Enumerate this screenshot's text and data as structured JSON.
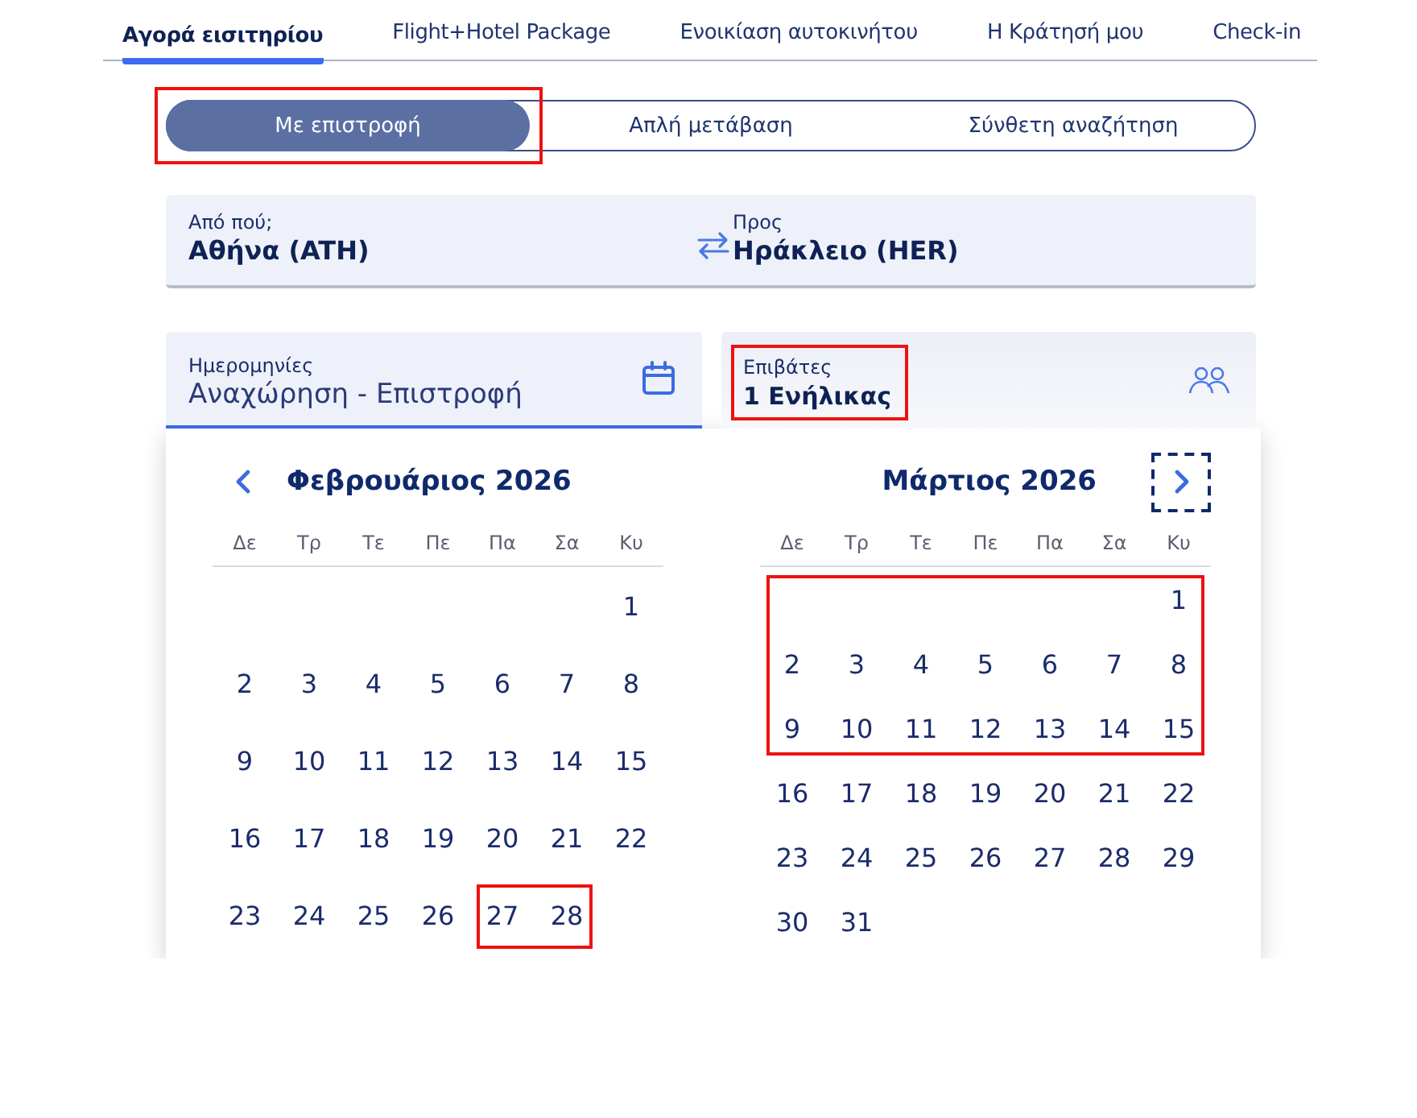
{
  "tabs": [
    {
      "label": "Αγορά εισιτηρίου",
      "selected": true
    },
    {
      "label": "Flight+Hotel Package",
      "selected": false
    },
    {
      "label": "Ενοικίαση αυτοκινήτου",
      "selected": false
    },
    {
      "label": "Η Κράτησή μου",
      "selected": false
    },
    {
      "label": "Check-in",
      "selected": false
    }
  ],
  "trip_types": [
    {
      "label": "Με επιστροφή",
      "selected": true,
      "highlighted": true
    },
    {
      "label": "Απλή μετάβαση",
      "selected": false,
      "highlighted": false
    },
    {
      "label": "Σύνθετη αναζήτηση",
      "selected": false,
      "highlighted": false
    }
  ],
  "route": {
    "from": {
      "label": "Από πού;",
      "value": "Αθήνα (ATH)"
    },
    "to": {
      "label": "Προς",
      "value": "Ηράκλειο (HER)"
    }
  },
  "dates": {
    "label": "Ημερομηνίες",
    "value": "Αναχώρηση - Επιστροφή",
    "selected": true
  },
  "passengers": {
    "label": "Επιβάτες",
    "value": "1 Ενήλικας",
    "selected": false,
    "highlighted": true
  },
  "calendar": {
    "next_focused": true,
    "months": [
      {
        "title": "Φεβρουάριος 2026",
        "weekdays": [
          "Δε",
          "Τρ",
          "Τε",
          "Πε",
          "Πα",
          "Σα",
          "Κυ"
        ],
        "day_groups": [
          {
            "highlighted": false,
            "days": [
              {
                "kind": "blank"
              },
              {
                "kind": "blank"
              },
              {
                "kind": "blank"
              },
              {
                "kind": "blank"
              },
              {
                "kind": "blank"
              },
              {
                "kind": "blank"
              },
              {
                "kind": "day",
                "label": "1"
              },
              {
                "kind": "day",
                "label": "2"
              },
              {
                "kind": "day",
                "label": "3"
              },
              {
                "kind": "day",
                "label": "4"
              },
              {
                "kind": "day",
                "label": "5"
              },
              {
                "kind": "day",
                "label": "6"
              },
              {
                "kind": "day",
                "label": "7"
              },
              {
                "kind": "day",
                "label": "8"
              },
              {
                "kind": "day",
                "label": "9"
              },
              {
                "kind": "day",
                "label": "10"
              },
              {
                "kind": "day",
                "label": "11"
              },
              {
                "kind": "day",
                "label": "12"
              },
              {
                "kind": "day",
                "label": "13"
              },
              {
                "kind": "day",
                "label": "14"
              },
              {
                "kind": "day",
                "label": "15"
              },
              {
                "kind": "day",
                "label": "16"
              },
              {
                "kind": "day",
                "label": "17"
              },
              {
                "kind": "day",
                "label": "18"
              },
              {
                "kind": "day",
                "label": "19"
              },
              {
                "kind": "day",
                "label": "20"
              },
              {
                "kind": "day",
                "label": "21"
              },
              {
                "kind": "day",
                "label": "22"
              },
              {
                "kind": "day",
                "label": "23"
              },
              {
                "kind": "day",
                "label": "24"
              },
              {
                "kind": "day",
                "label": "25"
              },
              {
                "kind": "day",
                "label": "26"
              }
            ]
          },
          {
            "highlighted": true,
            "days": [
              {
                "kind": "day",
                "label": "27"
              },
              {
                "kind": "day",
                "label": "28"
              }
            ]
          }
        ]
      },
      {
        "title": "Μάρτιος 2026",
        "weekdays": [
          "Δε",
          "Τρ",
          "Τε",
          "Πε",
          "Πα",
          "Σα",
          "Κυ"
        ],
        "day_groups": [
          {
            "highlighted": true,
            "days": [
              {
                "kind": "blank"
              },
              {
                "kind": "blank"
              },
              {
                "kind": "blank"
              },
              {
                "kind": "blank"
              },
              {
                "kind": "blank"
              },
              {
                "kind": "blank"
              },
              {
                "kind": "day",
                "label": "1"
              },
              {
                "kind": "day",
                "label": "2"
              },
              {
                "kind": "day",
                "label": "3"
              },
              {
                "kind": "day",
                "label": "4"
              },
              {
                "kind": "day",
                "label": "5"
              },
              {
                "kind": "day",
                "label": "6"
              },
              {
                "kind": "day",
                "label": "7"
              },
              {
                "kind": "day",
                "label": "8"
              },
              {
                "kind": "day",
                "label": "9"
              },
              {
                "kind": "day",
                "label": "10"
              },
              {
                "kind": "day",
                "label": "11"
              },
              {
                "kind": "day",
                "label": "12"
              },
              {
                "kind": "day",
                "label": "13"
              },
              {
                "kind": "day",
                "label": "14"
              },
              {
                "kind": "day",
                "label": "15"
              }
            ]
          },
          {
            "highlighted": false,
            "days": [
              {
                "kind": "day",
                "label": "16"
              },
              {
                "kind": "day",
                "label": "17"
              },
              {
                "kind": "day",
                "label": "18"
              },
              {
                "kind": "day",
                "label": "19"
              },
              {
                "kind": "day",
                "label": "20"
              },
              {
                "kind": "day",
                "label": "21"
              },
              {
                "kind": "day",
                "label": "22"
              },
              {
                "kind": "day",
                "label": "23"
              },
              {
                "kind": "day",
                "label": "24"
              },
              {
                "kind": "day",
                "label": "25"
              },
              {
                "kind": "day",
                "label": "26"
              },
              {
                "kind": "day",
                "label": "27"
              },
              {
                "kind": "day",
                "label": "28"
              },
              {
                "kind": "day",
                "label": "29"
              },
              {
                "kind": "day",
                "label": "30"
              },
              {
                "kind": "day",
                "label": "31"
              }
            ]
          }
        ]
      }
    ]
  }
}
